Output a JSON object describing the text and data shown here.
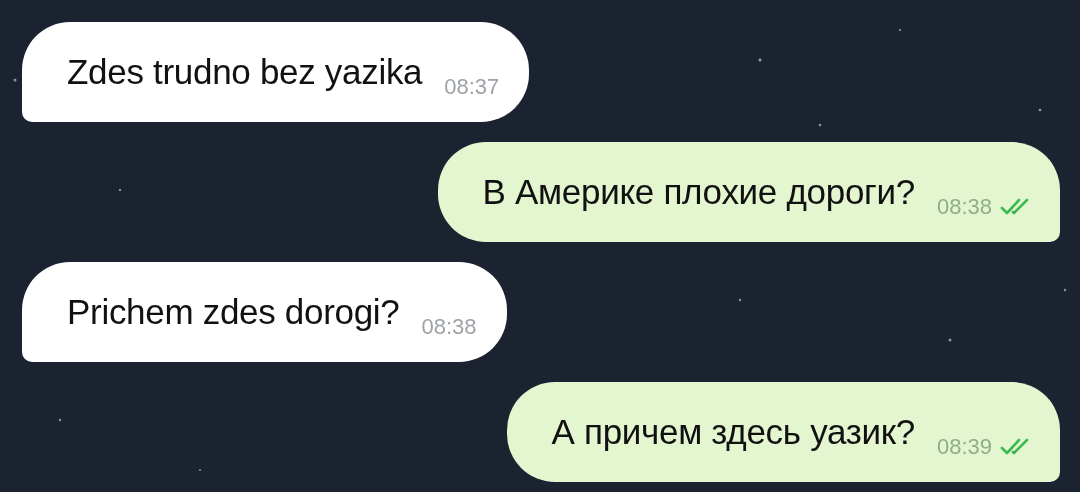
{
  "messages": [
    {
      "kind": "incoming",
      "text": "Zdes trudno bez yazika",
      "time": "08:37"
    },
    {
      "kind": "outgoing",
      "text": "В Америке плохие дороги?",
      "time": "08:38",
      "read": true
    },
    {
      "kind": "incoming",
      "text": "Prichem zdes dorogi?",
      "time": "08:38"
    },
    {
      "kind": "outgoing",
      "text": "А причем здесь уазик?",
      "time": "08:39",
      "read": true
    }
  ]
}
